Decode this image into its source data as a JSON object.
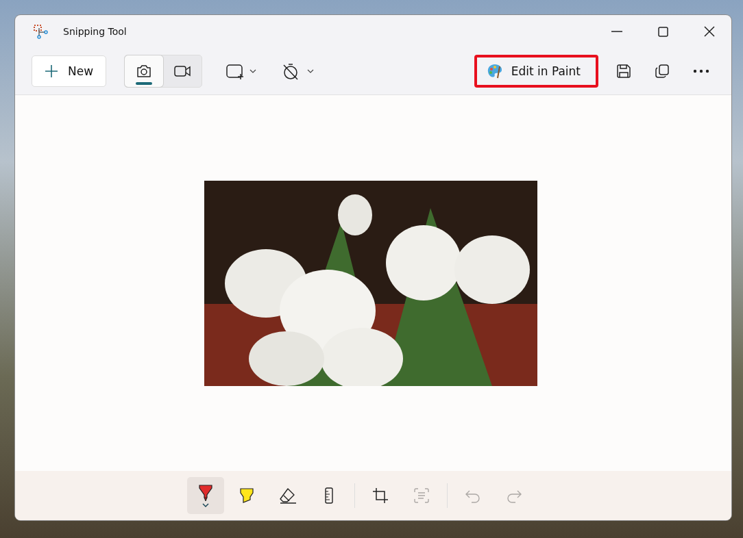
{
  "window": {
    "title": "Snipping Tool"
  },
  "toolbar": {
    "new_button": {
      "label": "New"
    },
    "capture_modes": [
      {
        "kind": "photo",
        "selected": true
      },
      {
        "kind": "video",
        "selected": false
      }
    ],
    "edit_in_paint": {
      "label": "Edit in Paint",
      "highlighted": true
    }
  },
  "markup_tool_groups": [
    [
      {
        "kind": "pen",
        "selected": true,
        "disabled": false
      },
      {
        "kind": "highlighter",
        "selected": false,
        "disabled": false
      },
      {
        "kind": "eraser",
        "selected": false,
        "disabled": false
      },
      {
        "kind": "ruler",
        "selected": false,
        "disabled": false
      }
    ],
    [
      {
        "kind": "crop",
        "selected": false,
        "disabled": false
      },
      {
        "kind": "text-actions",
        "selected": false,
        "disabled": true
      }
    ],
    [
      {
        "kind": "undo",
        "selected": false,
        "disabled": true
      },
      {
        "kind": "redo",
        "selected": false,
        "disabled": true
      }
    ]
  ]
}
